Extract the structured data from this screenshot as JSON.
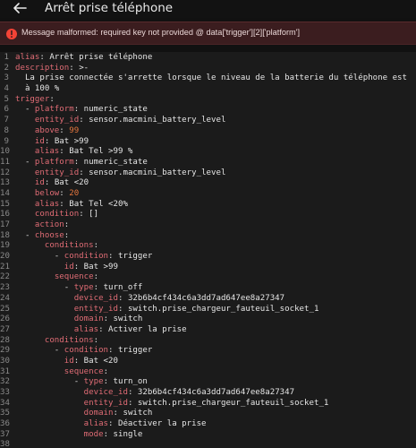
{
  "header": {
    "title": "Arrêt prise téléphone",
    "back_icon": "arrow-left-icon"
  },
  "error": {
    "icon": "error-circle-icon",
    "message": "Message malformed: required key not provided @ data['trigger'][2]['platform']",
    "color": "#f44336"
  },
  "editor": {
    "lines": [
      {
        "n": "1",
        "indent": "",
        "key": "alias",
        "sep": ": ",
        "val": "Arrêt prise téléphone",
        "vtype": "s"
      },
      {
        "n": "2",
        "indent": "",
        "key": "description",
        "sep": ": ",
        "val": ">-",
        "vtype": "s"
      },
      {
        "n": "3",
        "indent": "  ",
        "key": "",
        "sep": "",
        "val": "La prise connectée s'arrette lorsque le niveau de la batterie du téléphone est",
        "vtype": "s"
      },
      {
        "n": "4",
        "indent": "  ",
        "key": "",
        "sep": "",
        "val": "à 100 %",
        "vtype": "s"
      },
      {
        "n": "5",
        "indent": "",
        "key": "trigger",
        "sep": ":",
        "val": "",
        "vtype": "s"
      },
      {
        "n": "6",
        "indent": "  - ",
        "key": "platform",
        "sep": ": ",
        "val": "numeric_state",
        "vtype": "s"
      },
      {
        "n": "7",
        "indent": "    ",
        "key": "entity_id",
        "sep": ": ",
        "val": "sensor.macmini_battery_level",
        "vtype": "s"
      },
      {
        "n": "8",
        "indent": "    ",
        "key": "above",
        "sep": ": ",
        "val": "99",
        "vtype": "n"
      },
      {
        "n": "9",
        "indent": "    ",
        "key": "id",
        "sep": ": ",
        "val": "Bat >99",
        "vtype": "s"
      },
      {
        "n": "10",
        "indent": "    ",
        "key": "alias",
        "sep": ": ",
        "val": "Bat Tel >99 %",
        "vtype": "s"
      },
      {
        "n": "11",
        "indent": "  - ",
        "key": "platform",
        "sep": ": ",
        "val": "numeric_state",
        "vtype": "s"
      },
      {
        "n": "12",
        "indent": "    ",
        "key": "entity_id",
        "sep": ": ",
        "val": "sensor.macmini_battery_level",
        "vtype": "s"
      },
      {
        "n": "13",
        "indent": "    ",
        "key": "id",
        "sep": ": ",
        "val": "Bat <20",
        "vtype": "s"
      },
      {
        "n": "14",
        "indent": "    ",
        "key": "below",
        "sep": ": ",
        "val": "20",
        "vtype": "n"
      },
      {
        "n": "15",
        "indent": "    ",
        "key": "alias",
        "sep": ": ",
        "val": "Bat Tel <20%",
        "vtype": "s"
      },
      {
        "n": "16",
        "indent": "    ",
        "key": "condition",
        "sep": ": ",
        "val": "[]",
        "vtype": "s"
      },
      {
        "n": "17",
        "indent": "    ",
        "key": "action",
        "sep": ":",
        "val": "",
        "vtype": "s"
      },
      {
        "n": "18",
        "indent": "  - ",
        "key": "choose",
        "sep": ":",
        "val": "",
        "vtype": "s"
      },
      {
        "n": "19",
        "indent": "      ",
        "key": "conditions",
        "sep": ":",
        "val": "",
        "vtype": "s"
      },
      {
        "n": "20",
        "indent": "        - ",
        "key": "condition",
        "sep": ": ",
        "val": "trigger",
        "vtype": "s"
      },
      {
        "n": "21",
        "indent": "          ",
        "key": "id",
        "sep": ": ",
        "val": "Bat >99",
        "vtype": "s"
      },
      {
        "n": "22",
        "indent": "        ",
        "key": "sequence",
        "sep": ":",
        "val": "",
        "vtype": "s"
      },
      {
        "n": "23",
        "indent": "          - ",
        "key": "type",
        "sep": ": ",
        "val": "turn_off",
        "vtype": "s"
      },
      {
        "n": "24",
        "indent": "            ",
        "key": "device_id",
        "sep": ": ",
        "val": "32b6b4cf434c6a3dd7ad647ee8a27347",
        "vtype": "s"
      },
      {
        "n": "25",
        "indent": "            ",
        "key": "entity_id",
        "sep": ": ",
        "val": "switch.prise_chargeur_fauteuil_socket_1",
        "vtype": "s"
      },
      {
        "n": "26",
        "indent": "            ",
        "key": "domain",
        "sep": ": ",
        "val": "switch",
        "vtype": "s"
      },
      {
        "n": "27",
        "indent": "            ",
        "key": "alias",
        "sep": ": ",
        "val": "Activer la prise",
        "vtype": "s"
      },
      {
        "n": "28",
        "indent": "      ",
        "key": "conditions",
        "sep": ":",
        "val": "",
        "vtype": "s"
      },
      {
        "n": "29",
        "indent": "        - ",
        "key": "condition",
        "sep": ": ",
        "val": "trigger",
        "vtype": "s"
      },
      {
        "n": "30",
        "indent": "          ",
        "key": "id",
        "sep": ": ",
        "val": "Bat <20",
        "vtype": "s"
      },
      {
        "n": "31",
        "indent": "          ",
        "key": "sequence",
        "sep": ":",
        "val": "",
        "vtype": "s"
      },
      {
        "n": "32",
        "indent": "            - ",
        "key": "type",
        "sep": ": ",
        "val": "turn_on",
        "vtype": "s"
      },
      {
        "n": "33",
        "indent": "              ",
        "key": "device_id",
        "sep": ": ",
        "val": "32b6b4cf434c6a3dd7ad647ee8a27347",
        "vtype": "s"
      },
      {
        "n": "34",
        "indent": "              ",
        "key": "entity_id",
        "sep": ": ",
        "val": "switch.prise_chargeur_fauteuil_socket_1",
        "vtype": "s"
      },
      {
        "n": "35",
        "indent": "              ",
        "key": "domain",
        "sep": ": ",
        "val": "switch",
        "vtype": "s"
      },
      {
        "n": "36",
        "indent": "              ",
        "key": "alias",
        "sep": ": ",
        "val": "Déactiver la prise",
        "vtype": "s"
      },
      {
        "n": "37",
        "indent": "              ",
        "key": "mode",
        "sep": ": ",
        "val": "single",
        "vtype": "s"
      },
      {
        "n": "38",
        "indent": "",
        "key": "",
        "sep": "",
        "val": "",
        "vtype": "s"
      }
    ],
    "colors": {
      "key": "#e06c75",
      "number": "#e5763e",
      "text": "#e6e6e6",
      "gutter": "#8a8a8a"
    }
  }
}
